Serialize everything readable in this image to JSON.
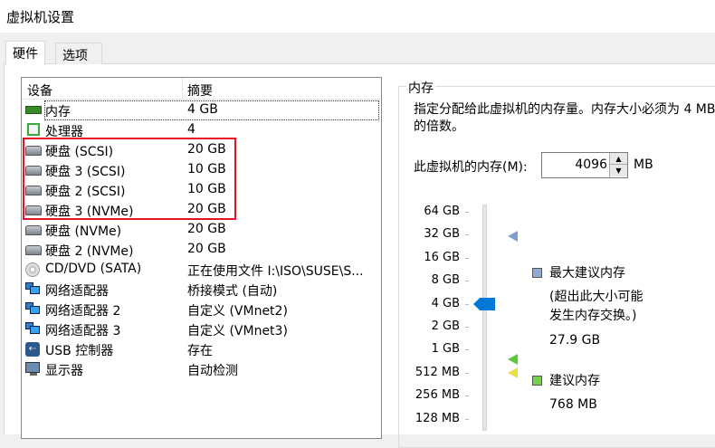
{
  "window": {
    "title": "虚拟机设置"
  },
  "tabs": [
    {
      "label": "硬件"
    },
    {
      "label": "选项"
    }
  ],
  "device_list": {
    "headers": {
      "device": "设备",
      "summary": "摘要"
    },
    "rows": [
      {
        "name": "内存",
        "summary": "4 GB",
        "icon": "memory-icon"
      },
      {
        "name": "处理器",
        "summary": "4",
        "icon": "cpu-icon"
      },
      {
        "name": "硬盘 (SCSI)",
        "summary": "20 GB",
        "icon": "hard-disk-icon"
      },
      {
        "name": "硬盘 3 (SCSI)",
        "summary": "10 GB",
        "icon": "hard-disk-icon"
      },
      {
        "name": "硬盘 2 (SCSI)",
        "summary": "10 GB",
        "icon": "hard-disk-icon"
      },
      {
        "name": "硬盘 3 (NVMe)",
        "summary": "20 GB",
        "icon": "hard-disk-icon"
      },
      {
        "name": "硬盘 (NVMe)",
        "summary": "20 GB",
        "icon": "hard-disk-icon"
      },
      {
        "name": "硬盘 2 (NVMe)",
        "summary": "20 GB",
        "icon": "hard-disk-icon"
      },
      {
        "name": "CD/DVD (SATA)",
        "summary": "正在使用文件 I:\\ISO\\SUSE\\S...",
        "icon": "cd-dvd-icon"
      },
      {
        "name": "网络适配器",
        "summary": "桥接模式 (自动)",
        "icon": "network-adapter-icon"
      },
      {
        "name": "网络适配器 2",
        "summary": "自定义 (VMnet2)",
        "icon": "network-adapter-icon"
      },
      {
        "name": "网络适配器 3",
        "summary": "自定义 (VMnet3)",
        "icon": "network-adapter-icon"
      },
      {
        "name": "USB 控制器",
        "summary": "存在",
        "icon": "usb-icon"
      },
      {
        "name": "显示器",
        "summary": "自动检测",
        "icon": "display-icon"
      }
    ]
  },
  "memory": {
    "group_title": "内存",
    "description_line1": "指定分配给此虚拟机的内存量。内存大小必须为 4 MB",
    "description_line2": "的倍数。",
    "field_label": "此虚拟机的内存(M):",
    "value": "4096",
    "unit": "MB",
    "scale": [
      "64 GB",
      "32 GB",
      "16 GB",
      "8 GB",
      "4 GB",
      "2 GB",
      "1 GB",
      "512 MB",
      "256 MB",
      "128 MB"
    ],
    "max_recommended": {
      "label": "最大建议内存",
      "note1": "(超出此大小可能",
      "note2": "发生内存交换。)",
      "value": "27.9 GB",
      "color": "#7f9fcf"
    },
    "recommended": {
      "label": "建议内存",
      "value": "768 MB",
      "color": "#5cc83a"
    },
    "guest_min_color": "#e8e040",
    "accent": "#0078d7"
  }
}
